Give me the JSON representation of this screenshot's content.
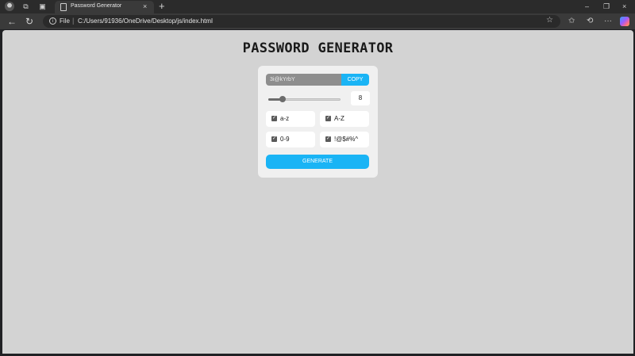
{
  "browser": {
    "tab_title": "Password Generator",
    "tab_close": "×",
    "new_tab": "+",
    "window_controls": {
      "minimize": "–",
      "restore": "❐",
      "close": "×"
    },
    "address_scheme": "File",
    "address_separator": "|",
    "address_url": "C:/Users/91936/OneDrive/Desktop/js/index.html",
    "nav": {
      "back": "←",
      "reload": "↻"
    },
    "toolbar_icons": {
      "favorite": "☆",
      "favorites": "✩",
      "history": "⟲",
      "more": "···"
    }
  },
  "app": {
    "title": "PASSWORD GENERATOR",
    "password": "3i@kYrbY",
    "copy_label": "COPY",
    "length": {
      "value": "8",
      "slider_fraction": 0.2
    },
    "options": [
      {
        "label": "a-z",
        "checked": true
      },
      {
        "label": "A-Z",
        "checked": true
      },
      {
        "label": "0-9",
        "checked": true
      },
      {
        "label": "!@$#%^",
        "checked": true
      }
    ],
    "checkmark": "✓",
    "generate_label": "GENERATE"
  },
  "colors": {
    "accent": "#1ab4f5",
    "page_bg": "#d3d3d3",
    "card_bg": "#f0f0f0",
    "password_field_bg": "#8e8e8e"
  }
}
